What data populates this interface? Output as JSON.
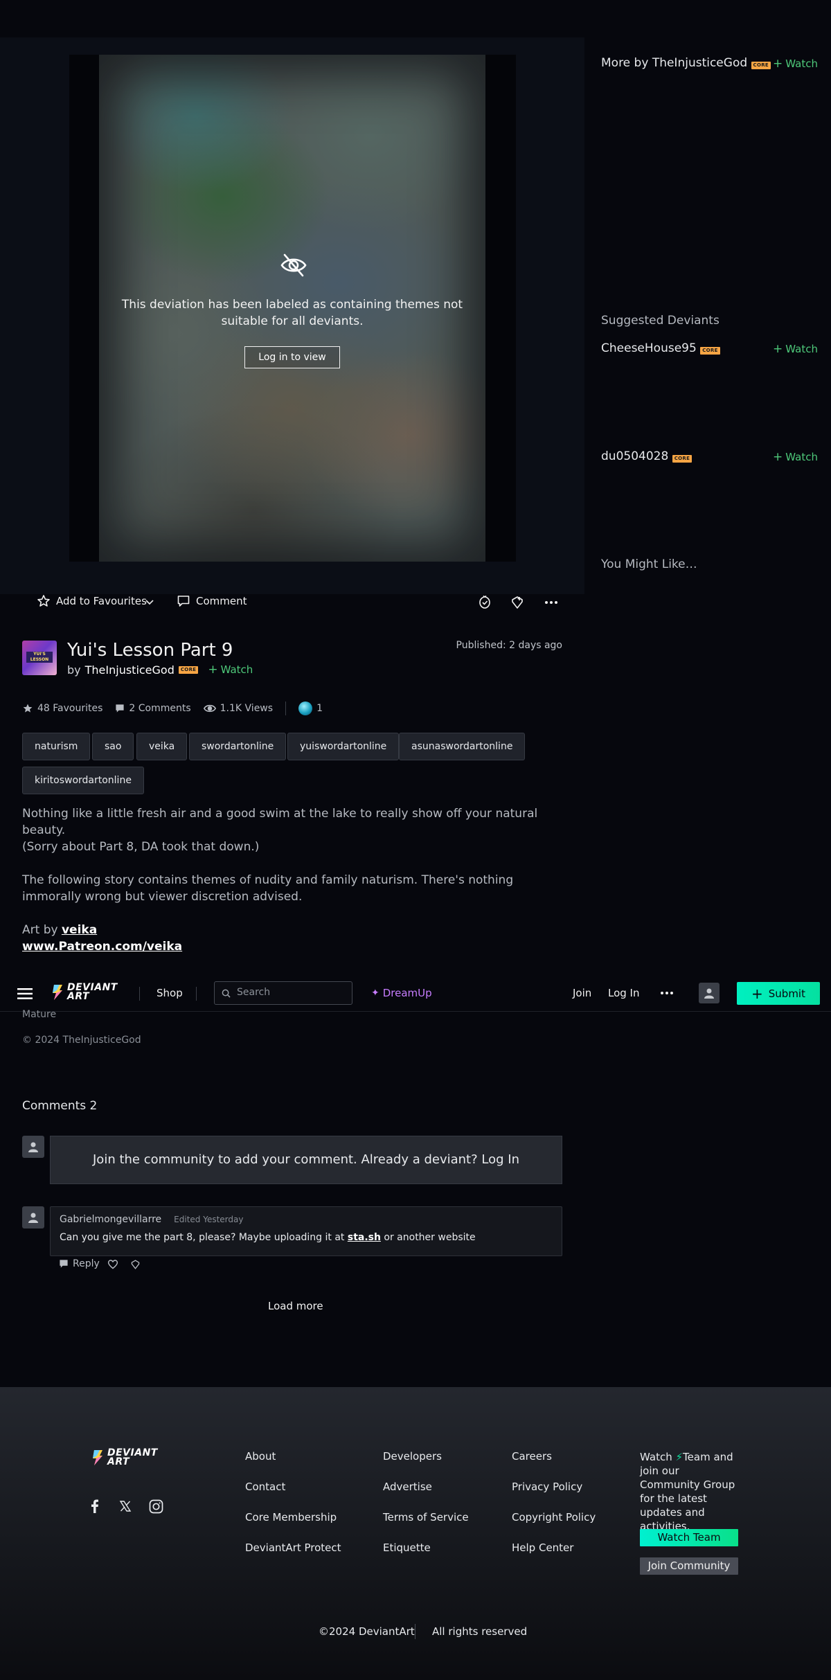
{
  "deviation": {
    "mature_notice": "This deviation has been labeled as containing themes not suitable for all deviants.",
    "login_to_view": "Log in to view",
    "title": "Yui's Lesson Part 9",
    "by": "by",
    "author": "TheInjusticeGod",
    "core_badge": "CORE",
    "watch": "Watch",
    "published": "Published: 2 days ago",
    "avatar_text": "YUI'S LESSON"
  },
  "actions": {
    "add_to_favourites": "Add to Favourites",
    "comment": "Comment"
  },
  "stats": {
    "favourites": "48 Favourites",
    "comments": "2 Comments",
    "views": "1.1K Views",
    "badges": "1"
  },
  "tags": [
    "naturism",
    "sao",
    "veika",
    "swordartonline",
    "yuiswordartonline",
    "asunaswordartonline",
    "kiritoswordartonline"
  ],
  "description": {
    "p1": "Nothing like a little fresh air and a good swim at the lake to really show off your natural beauty.",
    "p2": "(Sorry about Part 8, DA took that down.)",
    "p3": "The following story contains themes of nudity and family naturism. There's nothing immorally wrong but viewer discretion advised.",
    "art_by": "Art by",
    "artist": "veika",
    "patreon": "www.Patreon.com/veika",
    "mature": "Mature",
    "copyright": "© 2024 TheInjusticeGod"
  },
  "nav": {
    "logo": "DEVIANT ART",
    "shop": "Shop",
    "search_placeholder": "Search",
    "dreamup": "DreamUp",
    "join": "Join",
    "login": "Log In",
    "submit": "Submit"
  },
  "comments": {
    "heading": "Comments 2",
    "join_prompt": "Join the community to add your comment. Already a deviant? Log In",
    "items": [
      {
        "user": "Gabrielmongevillarre",
        "meta": "Edited Yesterday",
        "text_before": "Can you give me the part 8, please? Maybe uploading it at ",
        "link": "sta.sh",
        "text_after": " or another website",
        "reply": "Reply"
      }
    ],
    "load_more": "Load more"
  },
  "sidebar": {
    "more_by_prefix": "More by",
    "more_by_author": "TheInjusticeGod",
    "suggested_heading": "Suggested Deviants",
    "suggested": [
      {
        "name": "CheeseHouse95"
      },
      {
        "name": "du0504028"
      }
    ],
    "you_might_like": "You Might Like…",
    "watch": "Watch",
    "core_badge": "CORE"
  },
  "footer": {
    "logo": "DEVIANT ART",
    "col1": [
      "About",
      "Contact",
      "Core Membership",
      "DeviantArt Protect"
    ],
    "col2": [
      "Developers",
      "Advertise",
      "Terms of Service",
      "Etiquette"
    ],
    "col3": [
      "Careers",
      "Privacy Policy",
      "Copyright Policy",
      "Help Center"
    ],
    "watch_blurb_prefix": "Watch",
    "watch_blurb_rest": "Team and join our Community Group for the latest updates and activities.",
    "watch_team": "Watch Team",
    "join_community": "Join Community",
    "copyright": "©2024 DeviantArt",
    "rights": "All rights reserved"
  },
  "colors": {
    "accent_green": "#4ec97a",
    "submit_gradient": "#00f0c0",
    "core_badge": "#f7a544",
    "dreamup": "#c77dff",
    "background": "#06070d"
  }
}
